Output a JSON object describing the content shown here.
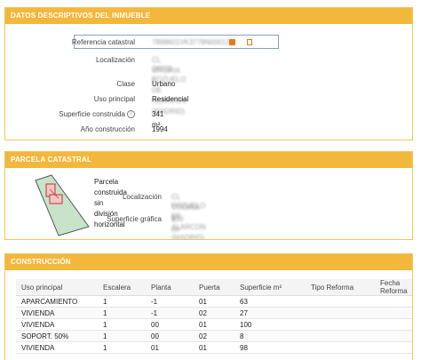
{
  "datos": {
    "header": "DATOS DESCRIPTIVOS DEL INMUEBLE",
    "fields": [
      {
        "label": "Referencia catastral",
        "value": "7898601VK3778N0001ZE",
        "blurred": true
      },
      {
        "label": "Localización",
        "value": "CL VITORIA 1",
        "value2": "28223 POZUELO DE ALARCON (MADRID)",
        "blurred": true
      },
      {
        "label": "Clase",
        "value": "Urbano"
      },
      {
        "label": "Uso principal",
        "value": "Residencial"
      },
      {
        "label": "Superficie construida",
        "value": "341 m²"
      },
      {
        "label": "Año construcción",
        "value": "1994"
      }
    ]
  },
  "parcela": {
    "header": "PARCELA CATASTRAL",
    "title": "Parcela construida sin división horizontal",
    "loc_label": "Localización",
    "loc_value": "CL VITORIA 1",
    "loc_value2": "POZUELO DE ALARCON (MADRID)",
    "sup_label": "Superficie gráfica",
    "sup_value": "920 m²"
  },
  "construccion": {
    "header": "CONSTRUCCIÓN",
    "columns": [
      "Uso principal",
      "Escalera",
      "Planta",
      "Puerta",
      "Superficie m²",
      "Tipo Reforma",
      "Fecha Reforma"
    ],
    "rows": [
      [
        "APARCAMIENTO",
        "1",
        "-1",
        "01",
        "63",
        "",
        ""
      ],
      [
        "VIVIENDA",
        "1",
        "-1",
        "02",
        "27",
        "",
        ""
      ],
      [
        "VIVIENDA",
        "1",
        "00",
        "01",
        "100",
        "",
        ""
      ],
      [
        "SOPORT. 50%",
        "1",
        "00",
        "02",
        "8",
        "",
        ""
      ],
      [
        "VIVIENDA",
        "1",
        "01",
        "01",
        "98",
        "",
        ""
      ]
    ]
  },
  "colors": {
    "header_bg": "#f3b73b",
    "border": "#f0c65a"
  }
}
